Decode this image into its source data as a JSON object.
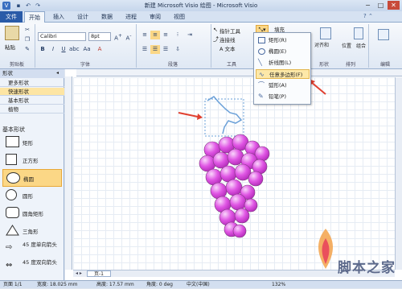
{
  "window": {
    "title": "新建 Microsoft Visio 绘图 - Microsoft Visio",
    "controls": [
      "−",
      "□",
      "✕"
    ]
  },
  "tabs": [
    "文件",
    "开始",
    "插入",
    "设计",
    "数据",
    "进程",
    "审阅",
    "视图"
  ],
  "ribbon": {
    "clipboard": {
      "paste": "粘贴",
      "label": "剪贴板"
    },
    "font": {
      "name": "Calibri",
      "size": "8pt",
      "label": "字体"
    },
    "paragraph": {
      "label": "段落"
    },
    "tools": {
      "pointer": "指针工具",
      "connector": "连接线",
      "text": "A 文本",
      "label": "工具"
    },
    "shape": {
      "fill": "填充",
      "label": "形状"
    },
    "arrange": {
      "align": "对齐和",
      "position": "位置",
      "group": "组合",
      "label": "排列"
    },
    "editing": {
      "label": "编辑"
    }
  },
  "menu": {
    "items": [
      "矩形(R)",
      "椭圆(E)",
      "折线图(L)",
      "任意多边形(F)",
      "弧形(A)",
      "铅笔(P)"
    ],
    "highlighted": 3
  },
  "sidebar": {
    "header": "形状",
    "nav": [
      "更多形状",
      "快速形状",
      "基本形状",
      "植物"
    ],
    "active_nav": 1,
    "stencil_title": "基本形状",
    "shapes": [
      "矩形",
      "正方形",
      "椭圆",
      "圆形",
      "圆角矩形",
      "三角形",
      "45 度单向箭头",
      "45 度双向箭头"
    ],
    "active_shape": 2
  },
  "page": {
    "tab": "页-1"
  },
  "status": {
    "page": "页面 1/1",
    "width": "宽度: 18.025 mm",
    "height": "高度: 17.57 mm",
    "angle": "角度: 0 deg",
    "language": "中文(中国)",
    "zoom": "132%"
  },
  "watermark": "脚本之家",
  "colors": {
    "grape": "#d84fdc",
    "arrow": "#e04030",
    "file_tab": "#2a5ba8"
  }
}
